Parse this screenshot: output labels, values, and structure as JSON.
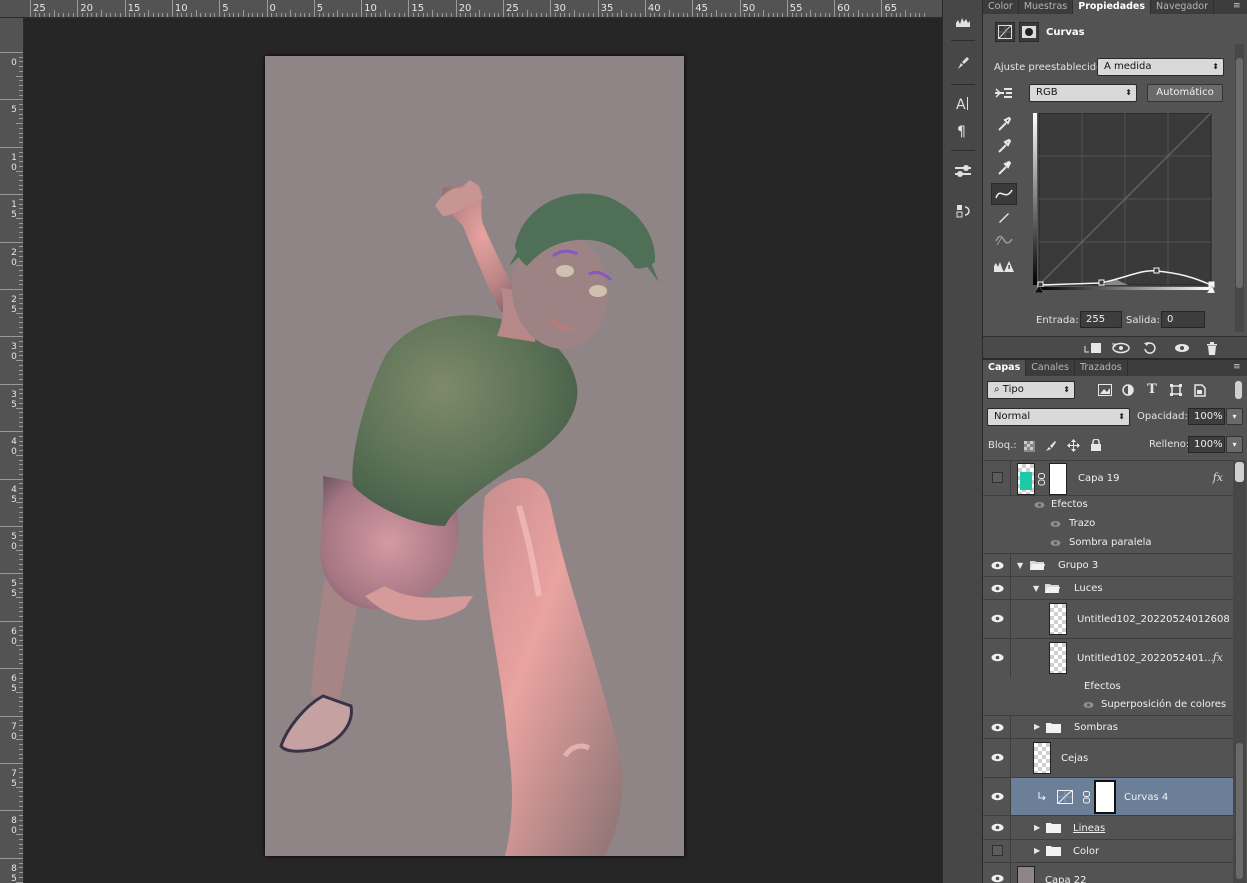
{
  "ruler": {
    "top_labels": [
      "25",
      "20",
      "15",
      "10",
      "5",
      "0",
      "5",
      "10",
      "15",
      "20",
      "25",
      "30",
      "35",
      "40",
      "45",
      "50",
      "55",
      "60",
      "65"
    ],
    "left_labels": [
      [
        "0"
      ],
      [
        "5"
      ],
      [
        "1",
        "0"
      ],
      [
        "1",
        "5"
      ],
      [
        "2",
        "0"
      ],
      [
        "2",
        "5"
      ],
      [
        "3",
        "0"
      ],
      [
        "3",
        "5"
      ],
      [
        "4",
        "0"
      ],
      [
        "4",
        "5"
      ],
      [
        "5",
        "0"
      ],
      [
        "5",
        "5"
      ],
      [
        "6",
        "0"
      ],
      [
        "6",
        "5"
      ],
      [
        "7",
        "0"
      ],
      [
        "7",
        "5"
      ],
      [
        "8",
        "0"
      ],
      [
        "8",
        "5"
      ]
    ]
  },
  "properties_panel": {
    "tabs": [
      "Color",
      "Muestras",
      "Propiedades",
      "Navegador"
    ],
    "active_tab": "Propiedades",
    "title": "Curvas",
    "preset_label": "Ajuste preestablecido:",
    "preset_value": "A medida",
    "channel_value": "RGB",
    "auto_button": "Automático",
    "input_label": "Entrada:",
    "input_value": "255",
    "output_label": "Salida:",
    "output_value": "0",
    "icons": {
      "adjustment_type": "curves-adjustment-icon",
      "mask": "layer-mask-icon",
      "targeted_adjust": "hand-targeted-adjust-icon",
      "eyedroppers": [
        "black-point-eyedropper-icon",
        "gray-point-eyedropper-icon",
        "white-point-eyedropper-icon"
      ],
      "curve_tools": [
        "edit-curve-points-icon",
        "pencil-draw-curve-icon",
        "smooth-curve-icon",
        "clipping-warning-icon"
      ],
      "bottom": [
        "clip-to-layer-icon",
        "view-previous-state-icon",
        "reset-icon",
        "visibility-icon",
        "trash-icon"
      ]
    }
  },
  "layers_panel": {
    "tabs": [
      "Capas",
      "Canales",
      "Trazados"
    ],
    "active_tab": "Capas",
    "filter_value": "Tipo",
    "blend_mode": "Normal",
    "opacity_label": "Opacidad:",
    "opacity_value": "100%",
    "lock_label": "Bloq.:",
    "fill_label": "Relleno:",
    "fill_value": "100%",
    "filter_icons": [
      "pixel-layer-filter-icon",
      "adjustment-layer-filter-icon",
      "type-layer-filter-icon",
      "shape-layer-filter-icon",
      "smart-object-filter-icon"
    ],
    "layers": [
      {
        "name": "Capa 19",
        "visible": false,
        "fx": "fx",
        "thumb_color": "#1ec9a8"
      },
      {
        "name": "Efectos",
        "kind": "effects-header"
      },
      {
        "name": "Trazo",
        "kind": "effect"
      },
      {
        "name": "Sombra paralela",
        "kind": "effect"
      },
      {
        "name": "Grupo 3",
        "visible": true,
        "kind": "group-open"
      },
      {
        "name": "Luces",
        "visible": true,
        "kind": "group-open"
      },
      {
        "name": "Untitled102_20220524012608",
        "visible": true
      },
      {
        "name": "Untitled102_2022052401...",
        "visible": true,
        "fx": "fx"
      },
      {
        "name": "Efectos",
        "kind": "effects-header"
      },
      {
        "name": "Superposición de colores",
        "kind": "effect"
      },
      {
        "name": "Sombras",
        "visible": true,
        "kind": "group-closed"
      },
      {
        "name": "Cejas",
        "visible": true
      },
      {
        "name": "Curvas 4",
        "visible": true,
        "selected": true,
        "kind": "adjustment"
      },
      {
        "name": "Lineas",
        "visible": true,
        "kind": "group-closed"
      },
      {
        "name": "Color",
        "visible": false,
        "kind": "group-closed"
      },
      {
        "name": "Capa 22",
        "visible": true
      }
    ]
  },
  "colors": {
    "panel_bg": "#535353",
    "selected_layer": "#6b8098",
    "artboard_bg": "#8f8586"
  }
}
